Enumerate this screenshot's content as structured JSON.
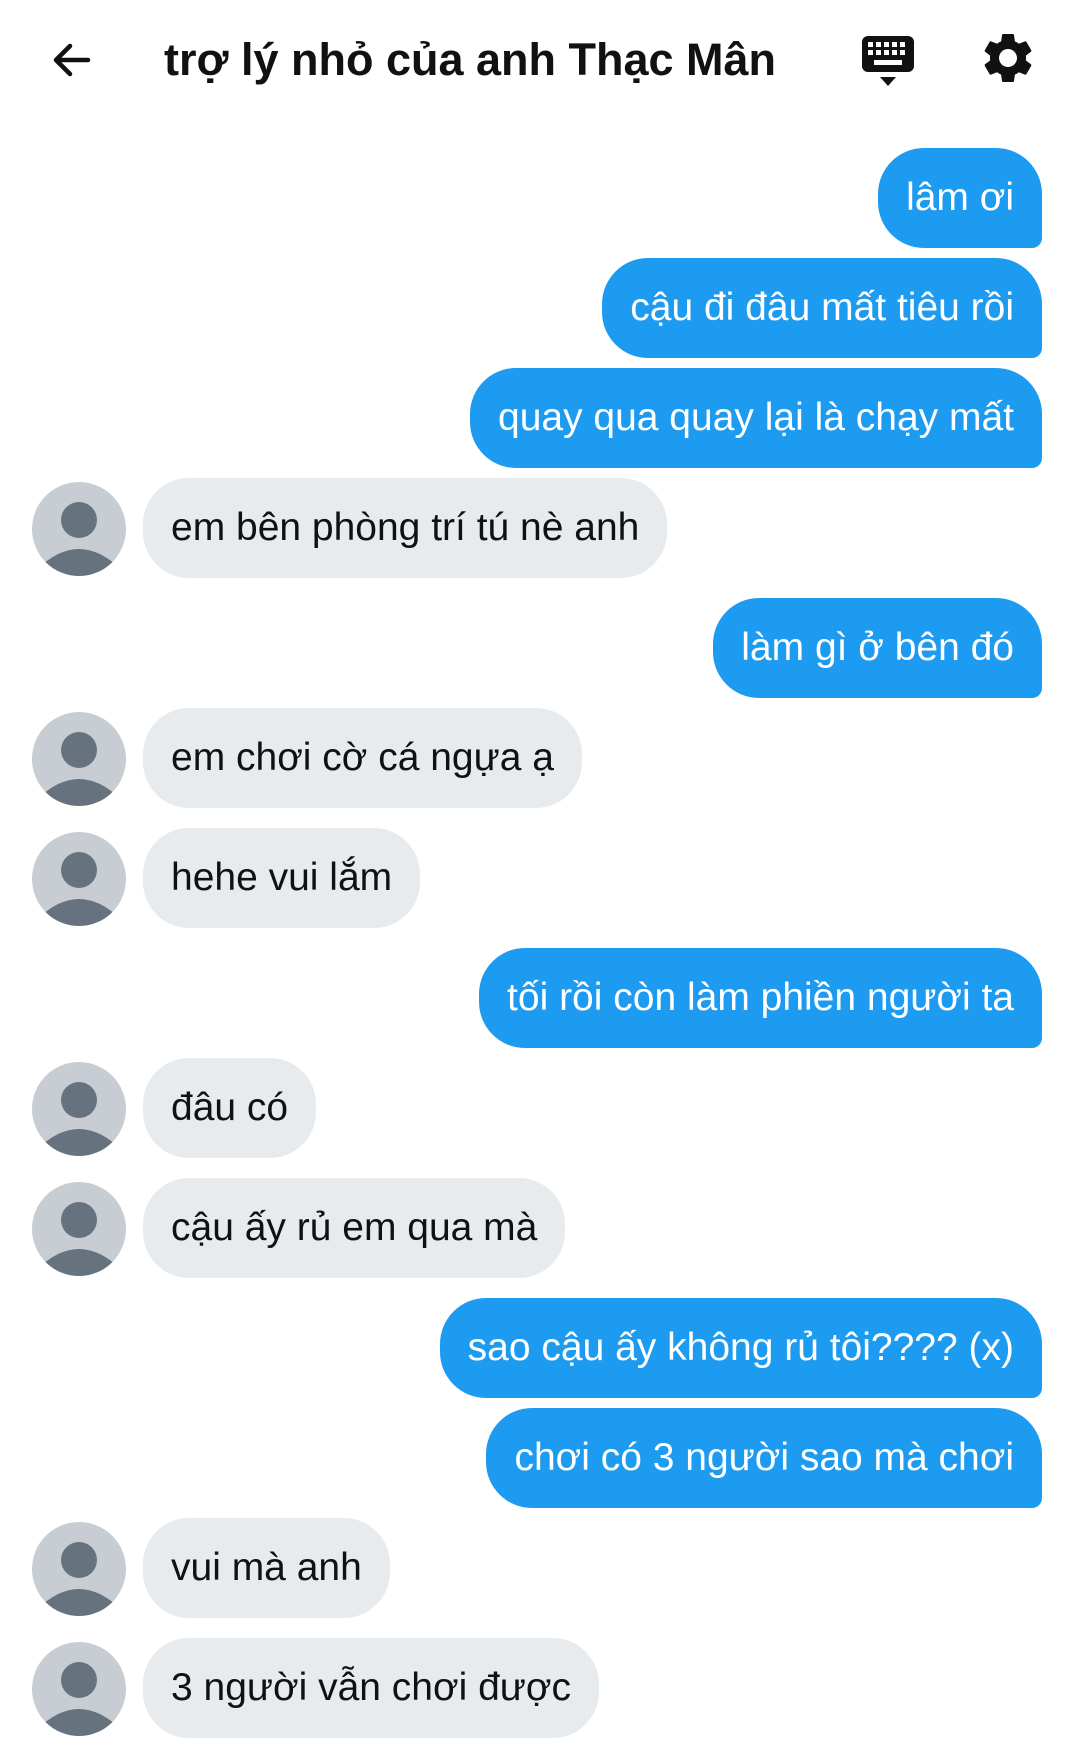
{
  "header": {
    "title": "trợ lý nhỏ của anh Thạc Mân",
    "back_icon": "arrow-left-icon",
    "keyboard_icon": "keyboard-icon",
    "settings_icon": "gear-icon"
  },
  "colors": {
    "sent_bubble": "#1d9bf0",
    "received_bubble": "#e8ebee",
    "avatar_bg": "#c7cdd3",
    "avatar_fg": "#66737f"
  },
  "messages": [
    {
      "from": "me",
      "text": "lâm ơi"
    },
    {
      "from": "me",
      "text": "cậu đi đâu mất tiêu rồi"
    },
    {
      "from": "me",
      "text": "quay qua quay lại là chạy mất"
    },
    {
      "from": "them",
      "text": "em bên phòng trí tú nè anh"
    },
    {
      "from": "me",
      "text": "làm gì ở bên đó"
    },
    {
      "from": "them",
      "text": "em chơi cờ cá ngựa ạ"
    },
    {
      "from": "them",
      "text": "hehe vui lắm"
    },
    {
      "from": "me",
      "text": "tối rồi còn làm phiền người ta"
    },
    {
      "from": "them",
      "text": "đâu có"
    },
    {
      "from": "them",
      "text": "cậu ấy rủ em qua mà"
    },
    {
      "from": "me",
      "text": "sao cậu ấy không rủ tôi???? (x)"
    },
    {
      "from": "me",
      "text": "chơi có 3 người sao mà chơi"
    },
    {
      "from": "them",
      "text": "vui mà anh"
    },
    {
      "from": "them",
      "text": "3 người vẫn chơi được"
    }
  ]
}
